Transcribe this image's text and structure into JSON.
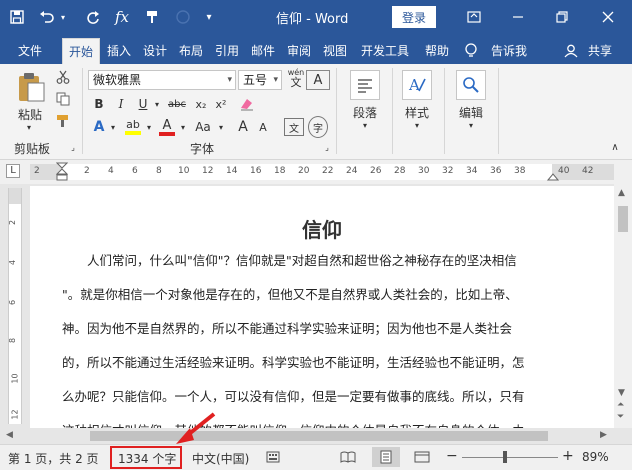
{
  "titlebar": {
    "doc_title": "信仰 - Word",
    "login_label": "登录",
    "fx_label": "fx"
  },
  "tabs": [
    {
      "label": "文件",
      "active": false
    },
    {
      "label": "开始",
      "active": true
    },
    {
      "label": "插入",
      "active": false
    },
    {
      "label": "设计",
      "active": false
    },
    {
      "label": "布局",
      "active": false
    },
    {
      "label": "引用",
      "active": false
    },
    {
      "label": "邮件",
      "active": false
    },
    {
      "label": "审阅",
      "active": false
    },
    {
      "label": "视图",
      "active": false
    },
    {
      "label": "开发工具",
      "active": false
    },
    {
      "label": "帮助",
      "active": false
    }
  ],
  "tell_me": "告诉我",
  "share": "共享",
  "ribbon": {
    "clipboard": {
      "paste_label": "粘贴",
      "group_label": "剪贴板"
    },
    "font": {
      "font_name": "微软雅黑",
      "font_size": "五号",
      "pinyin_glyph": "wén",
      "bold": "B",
      "italic": "I",
      "underline": "U",
      "strike": "abc",
      "subscript": "x₂",
      "superscript": "x²",
      "text_effect": "A",
      "highlight": "ab",
      "font_color": "A",
      "change_case": "Aa",
      "grow": "A",
      "shrink": "A",
      "phonetic": "文",
      "char_border": "A",
      "enclose": "字",
      "group_label": "字体"
    },
    "paragraph": {
      "label": "段落"
    },
    "styles": {
      "label": "样式"
    },
    "editing": {
      "label": "编辑"
    }
  },
  "ruler": {
    "corner": "L",
    "numbers": [
      "2",
      "2",
      "4",
      "6",
      "8",
      "10",
      "12",
      "14",
      "16",
      "18",
      "20",
      "22",
      "24",
      "26",
      "28",
      "30",
      "32",
      "34",
      "36",
      "38",
      "40",
      "42"
    ],
    "vnumbers": [
      "2",
      "4",
      "6",
      "8",
      "10",
      "12"
    ]
  },
  "document": {
    "heading": "信仰",
    "lines": [
      "　　人们常问，什么叫\"信仰\"？信仰就是\"对超自然和超世俗之神秘存在的坚决相信",
      "\"。就是你相信一个对象他是存在的，但他又不是自然界或人类社会的，比如上帝、",
      "神。因为他不是自然界的，所以不能通过科学实验来证明；因为他也不是人类社会",
      "的，所以不能通过生活经验来证明。科学实验也不能证明，生活经验也不能证明，怎",
      "么办呢？只能信仰。一个人，可以没有信仰，但是一定要有做事的底线。所以，只有",
      "这种相信才叫信仰，其他的都不能叫信仰。信仰中的个体是自我不在自身的个体，由"
    ]
  },
  "status": {
    "page_info": "第 1 页，共 2 页",
    "word_count": "1334 个字",
    "language": "中文(中国)",
    "zoom_level": "89%",
    "zoom_minus": "−",
    "zoom_plus": "+",
    "zoom_fraction": 0.89
  },
  "colors": {
    "brand": "#2b579a",
    "highlight_box": "#e02020",
    "highlight_yellow": "#ffff00",
    "font_red": "#e02020"
  }
}
